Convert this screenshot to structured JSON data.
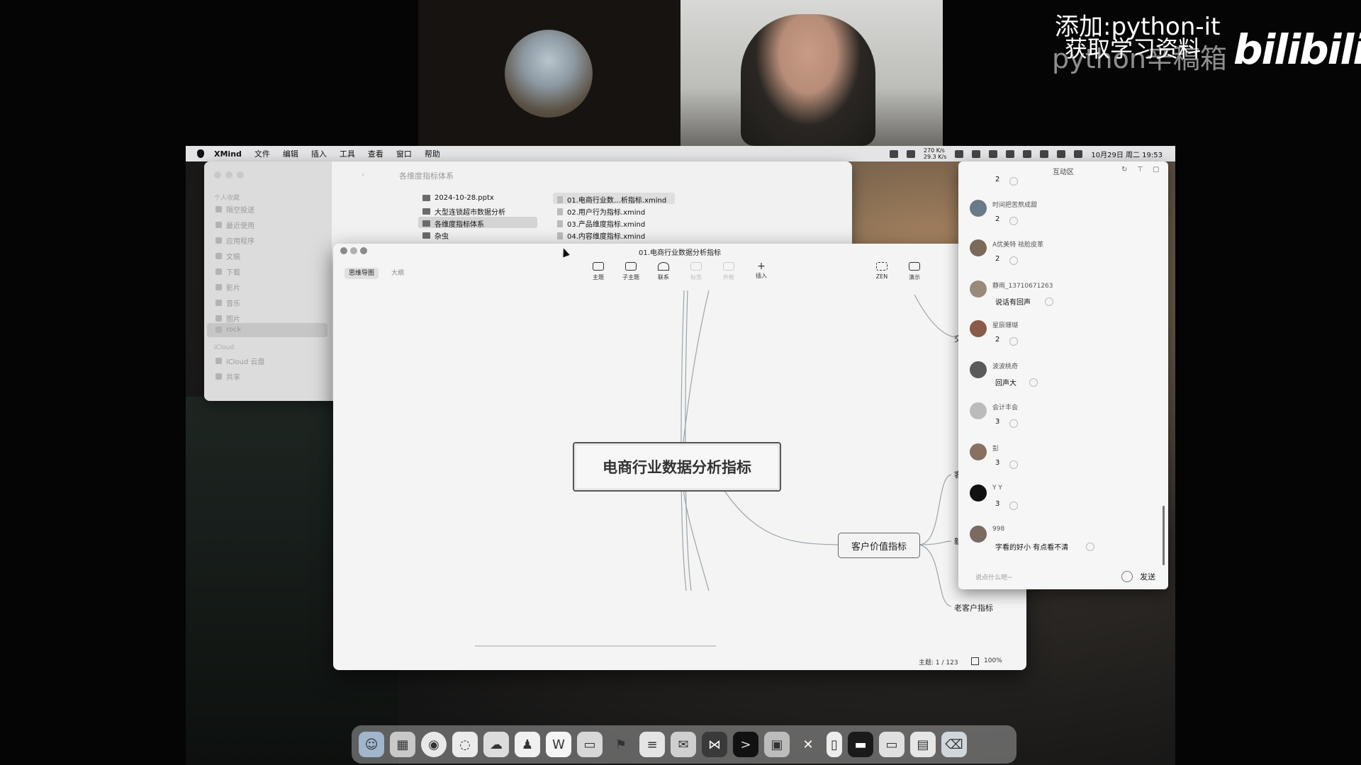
{
  "watermark": {
    "line1": "添加:python-it",
    "line2": "获取学习资料",
    "line3": "python辛稿箱",
    "logo": "bilibili"
  },
  "menubar": {
    "app": "XMind",
    "items": [
      "文件",
      "编辑",
      "插入",
      "工具",
      "查看",
      "窗口",
      "帮助"
    ],
    "net_up": "270 K/s",
    "net_down": "29.3 K/s",
    "datetime": "10月29日 周二 19:53"
  },
  "finder": {
    "title": "各维度指标体系",
    "sidebar": {
      "section_personal": "个人收藏",
      "items": [
        "隔空投送",
        "最近使用",
        "应用程序",
        "文稿",
        "下载",
        "影片",
        "音乐",
        "图片",
        "rock"
      ],
      "section_icloud": "iCloud",
      "icloud_items": [
        "iCloud 云盘",
        "共享"
      ]
    },
    "col1": [
      "2024-10-28.pptx",
      "大型连锁超市数据分析",
      "各维度指标体系",
      "杂虫"
    ],
    "col2": [
      "01.电商行业数…析指标.xmind",
      "02.用户行为指标.xmind",
      "03.产品维度指标.xmind",
      "04.内容维度指标.xmind"
    ]
  },
  "xmind": {
    "title": "01.电商行业数据分析指标",
    "tabs": [
      "思维导图",
      "大纲"
    ],
    "tools": [
      "主题",
      "子主题",
      "联系",
      "标签",
      "外框",
      "插入"
    ],
    "right_tools": [
      "ZEN",
      "演示"
    ],
    "central_topic": "电商行业数据分析指标",
    "customer_value_topic": "客户价值指标",
    "old_customer_topic": "老客户指标",
    "edge_labels": [
      "交",
      "客",
      "新"
    ],
    "status": "主题: 1 / 123",
    "zoom": "100%"
  },
  "chat": {
    "title": "互动区",
    "messages": [
      {
        "name": "",
        "text": "2"
      },
      {
        "name": "时间把苦熬成甜",
        "text": "2"
      },
      {
        "name": "A优美特 祛脸皮革",
        "text": "2"
      },
      {
        "name": "静雨_13710671263",
        "text": "说话有回声"
      },
      {
        "name": "星辰珊瑚",
        "text": "2"
      },
      {
        "name": "波波桃奇",
        "text": "回声大"
      },
      {
        "name": "会计丰会",
        "text": "3"
      },
      {
        "name": "彭",
        "text": "3"
      },
      {
        "name": "Y Y",
        "text": "3"
      },
      {
        "name": "998",
        "text": "字看的好小 有点看不清"
      }
    ],
    "input_placeholder": "说点什么吧~",
    "send": "发送"
  },
  "dock": [
    "Finder",
    "Launchpad",
    "Chrome",
    "Messages",
    "WeChat",
    "QQ",
    "WPS",
    "Preview",
    "Flag",
    "Notes",
    "Mail",
    "VSCode",
    "Terminal",
    "Photos",
    "XMind",
    "Docs",
    "Screen",
    "Window",
    "Files",
    "Trash"
  ],
  "colors": {
    "menubar": "#e4e4e6",
    "window": "#f4f4f4",
    "accent": "#555555"
  }
}
